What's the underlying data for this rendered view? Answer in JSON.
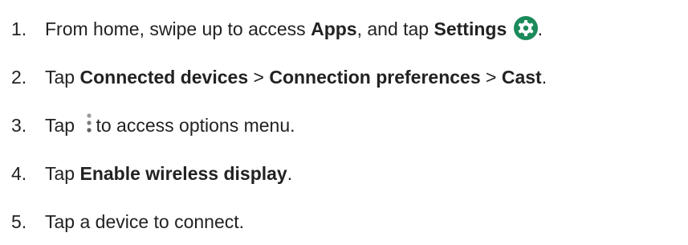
{
  "steps": [
    {
      "number": "1.",
      "t1": "From home, swipe up to access ",
      "b1": "Apps",
      "t2": ", and tap ",
      "b2": "Settings",
      "t3": ".",
      "icon": "settings-gear-icon"
    },
    {
      "number": "2.",
      "t1": "Tap ",
      "b1": "Connected devices",
      "t2": " > ",
      "b2": "Connection preferences",
      "t3": " > ",
      "b3": "Cast",
      "t4": "."
    },
    {
      "number": "3.",
      "t1": "Tap ",
      "t2": "to access options menu.",
      "icon": "more-options-icon"
    },
    {
      "number": "4.",
      "t1": "Tap ",
      "b1": "Enable wireless display",
      "t2": "."
    },
    {
      "number": "5.",
      "t1": "Tap a device to connect."
    }
  ],
  "colors": {
    "text": "#222222",
    "settings_icon_bg": "#1b8a5a"
  }
}
